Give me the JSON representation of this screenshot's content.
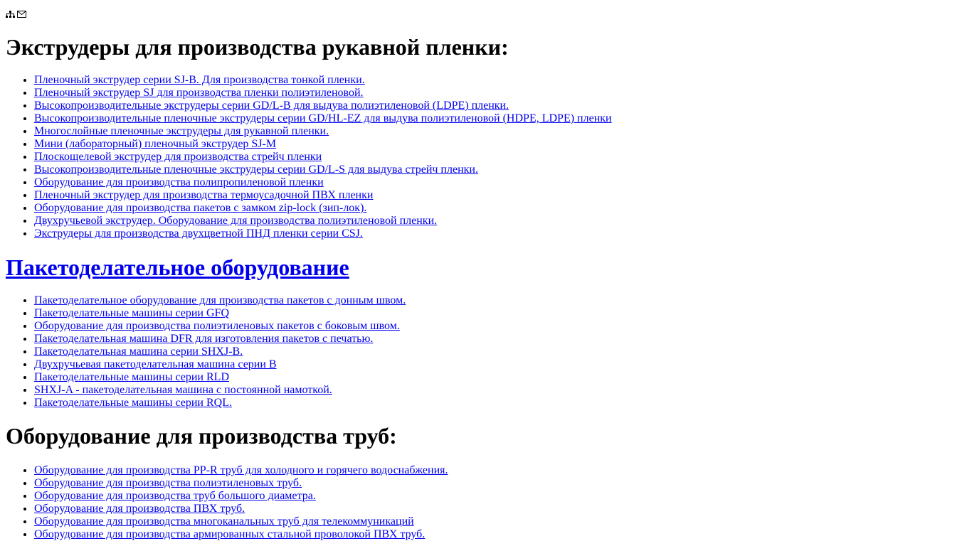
{
  "header": {
    "sitemap_icon": "sitemap-icon",
    "mail_icon": "envelope-icon"
  },
  "sections": [
    {
      "title": "Экструдеры для производства рукавной пленки:",
      "items": [
        "Пленочный экструдер серии SJ-B. Для производства тонкой пленки.",
        "Пленочный экструдер SJ для производства пленки полиэтиленовой.",
        "Высокопроизводительные экструдеры серии GD/L-B для выдува полиэтиленовой (LDPE) пленки.",
        "Высокопроизводительные пленочные экструдеры серии GD/HL-EZ для выдува полиэтиленовой (HDPE, LDPE) пленки",
        "Многослойные пленочные экструдеры для рукавной пленки.",
        "Мини (лабораторный) пленочный экструдер SJ-M",
        "Плоскощелевой экструдер для производства стрейч пленки",
        "Высокопроизводительные пленочные экструдеры серии GD/L-S для выдува стрейч пленки.",
        "Оборудование для производства полипропиленовой пленки",
        "Пленочный экструдер для производства термоусадочной ПВХ пленки",
        "Оборудование для производства пакетов с замком zip-lock (зип-лок).",
        "Двухручьевой экструдер. Оборудование для производства полиэтиленовой пленки.",
        "Экструдеры для производства двухцветной ПНД пленки серии CSJ."
      ]
    },
    {
      "title": "Пакетоделательное оборудование",
      "items": [
        "Пакетоделательное оборудование для производства пакетов с донным швом.",
        "Пакетоделательные машины серии GFQ",
        "Оборудование для производства полиэтиленовых пакетов с боковым швом.",
        "Пакетоделательная машина DFR для изготовления пакетов с печатью.",
        "Пакетоделательная машина серии SHXJ-B.",
        "Двухручьевая пакетоделательная машина серии B",
        "Пакетоделательные машины серии RLD",
        "SHXJ-A - пакетоделательная машина с постоянной намоткой.",
        "Пакетоделательные машины серии RQL."
      ]
    },
    {
      "title": "Оборудование для производства труб:",
      "items": [
        "Оборудование для производства PP-R труб для холодного и горячего водоснабжения.",
        "Оборудование для производства полиэтиленовых труб.",
        "Оборудование для производства труб большого диаметра.",
        "Оборудование для производства ПВХ труб.",
        "Оборудование для производства многоканальных труб для телекоммуникаций",
        "Оборудование для производства армированных стальной проволокой ПВХ труб."
      ]
    }
  ],
  "colors": {
    "link": "#0000ee",
    "text": "#000000",
    "background": "#ffffff"
  }
}
